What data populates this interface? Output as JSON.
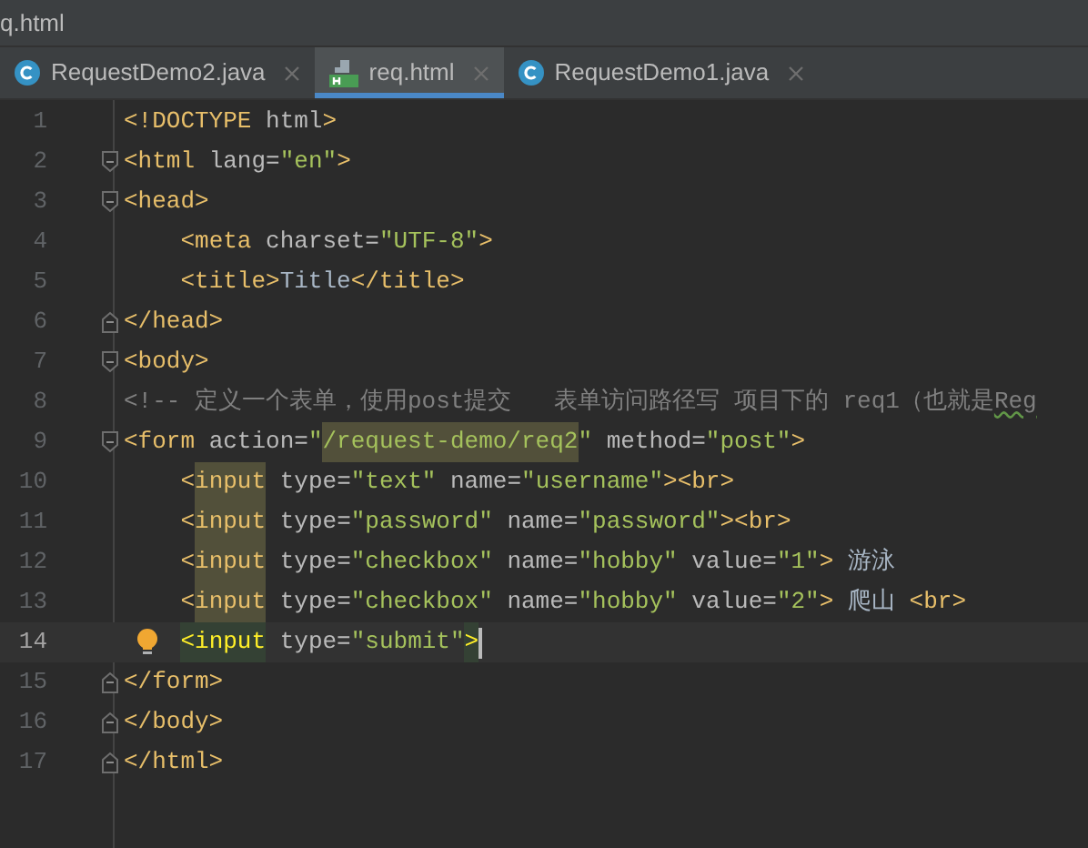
{
  "window": {
    "title": "q.html"
  },
  "tabs": [
    {
      "label": "RequestDemo2.java",
      "kind": "class",
      "selected": false
    },
    {
      "label": "req.html",
      "kind": "html",
      "selected": true
    },
    {
      "label": "RequestDemo1.java",
      "kind": "class",
      "selected": false
    }
  ],
  "editor": {
    "lines": [
      {
        "number": "1",
        "fold_start": false,
        "fold_end": false,
        "current": false,
        "bulb": false,
        "tokens": [
          {
            "text": "<!DOCTYPE",
            "kind": "tag"
          },
          {
            "text": " html",
            "kind": "attr"
          },
          {
            "text": ">",
            "kind": "tag"
          }
        ]
      },
      {
        "number": "2",
        "fold_start": true,
        "fold_end": false,
        "current": false,
        "bulb": false,
        "tokens": [
          {
            "text": "<html",
            "kind": "tag"
          },
          {
            "text": " lang=",
            "kind": "attr"
          },
          {
            "text": "\"en\"",
            "kind": "str"
          },
          {
            "text": ">",
            "kind": "tag"
          }
        ]
      },
      {
        "number": "3",
        "fold_start": true,
        "fold_end": false,
        "current": false,
        "bulb": false,
        "tokens": [
          {
            "text": "<head>",
            "kind": "tag"
          }
        ]
      },
      {
        "number": "4",
        "fold_start": false,
        "fold_end": false,
        "current": false,
        "bulb": false,
        "tokens": [
          {
            "text": "    <meta",
            "kind": "tag"
          },
          {
            "text": " charset=",
            "kind": "attr"
          },
          {
            "text": "\"UTF-8\"",
            "kind": "str"
          },
          {
            "text": ">",
            "kind": "tag"
          }
        ]
      },
      {
        "number": "5",
        "fold_start": false,
        "fold_end": false,
        "current": false,
        "bulb": false,
        "tokens": [
          {
            "text": "    <title>",
            "kind": "tag"
          },
          {
            "text": "Title",
            "kind": "text"
          },
          {
            "text": "</title>",
            "kind": "tag"
          }
        ]
      },
      {
        "number": "6",
        "fold_start": false,
        "fold_end": true,
        "current": false,
        "bulb": false,
        "tokens": [
          {
            "text": "</head>",
            "kind": "tag"
          }
        ]
      },
      {
        "number": "7",
        "fold_start": true,
        "fold_end": false,
        "current": false,
        "bulb": false,
        "tokens": [
          {
            "text": "<body>",
            "kind": "tag"
          }
        ]
      },
      {
        "number": "8",
        "fold_start": false,
        "fold_end": false,
        "current": false,
        "bulb": false,
        "tokens": [
          {
            "text": "<!-- 定义一个表单，使用post提交   表单访问路径写 项目下的 req1（也就是",
            "kind": "comment"
          },
          {
            "text": "Reg",
            "kind": "comment_typo"
          }
        ]
      },
      {
        "number": "9",
        "fold_start": true,
        "fold_end": false,
        "current": false,
        "bulb": false,
        "tokens": [
          {
            "text": "<form",
            "kind": "tag"
          },
          {
            "text": " action=",
            "kind": "attr"
          },
          {
            "text": "\"",
            "kind": "str"
          },
          {
            "text": "/request-demo/req2",
            "kind": "str_match"
          },
          {
            "text": "\"",
            "kind": "str"
          },
          {
            "text": " method=",
            "kind": "attr"
          },
          {
            "text": "\"post\"",
            "kind": "str"
          },
          {
            "text": ">",
            "kind": "tag"
          }
        ]
      },
      {
        "number": "10",
        "fold_start": false,
        "fold_end": false,
        "current": false,
        "bulb": false,
        "tokens": [
          {
            "text": "    <",
            "kind": "tag"
          },
          {
            "text": "input",
            "kind": "tag_match"
          },
          {
            "text": " type=",
            "kind": "attr"
          },
          {
            "text": "\"text\"",
            "kind": "str"
          },
          {
            "text": " name=",
            "kind": "attr"
          },
          {
            "text": "\"username\"",
            "kind": "str"
          },
          {
            "text": "><br>",
            "kind": "tag"
          }
        ]
      },
      {
        "number": "11",
        "fold_start": false,
        "fold_end": false,
        "current": false,
        "bulb": false,
        "tokens": [
          {
            "text": "    <",
            "kind": "tag"
          },
          {
            "text": "input",
            "kind": "tag_match"
          },
          {
            "text": " type=",
            "kind": "attr"
          },
          {
            "text": "\"password\"",
            "kind": "str"
          },
          {
            "text": " name=",
            "kind": "attr"
          },
          {
            "text": "\"password\"",
            "kind": "str"
          },
          {
            "text": "><br>",
            "kind": "tag"
          }
        ]
      },
      {
        "number": "12",
        "fold_start": false,
        "fold_end": false,
        "current": false,
        "bulb": false,
        "tokens": [
          {
            "text": "    <",
            "kind": "tag"
          },
          {
            "text": "input",
            "kind": "tag_match"
          },
          {
            "text": " type=",
            "kind": "attr"
          },
          {
            "text": "\"checkbox\"",
            "kind": "str"
          },
          {
            "text": " name=",
            "kind": "attr"
          },
          {
            "text": "\"hobby\"",
            "kind": "str"
          },
          {
            "text": " value=",
            "kind": "attr"
          },
          {
            "text": "\"1\"",
            "kind": "str"
          },
          {
            "text": ">",
            "kind": "tag"
          },
          {
            "text": " 游泳",
            "kind": "text"
          }
        ]
      },
      {
        "number": "13",
        "fold_start": false,
        "fold_end": false,
        "current": false,
        "bulb": false,
        "tokens": [
          {
            "text": "    <",
            "kind": "tag"
          },
          {
            "text": "input",
            "kind": "tag_match"
          },
          {
            "text": " type=",
            "kind": "attr"
          },
          {
            "text": "\"checkbox\"",
            "kind": "str"
          },
          {
            "text": " name=",
            "kind": "attr"
          },
          {
            "text": "\"hobby\"",
            "kind": "str"
          },
          {
            "text": " value=",
            "kind": "attr"
          },
          {
            "text": "\"2\"",
            "kind": "str"
          },
          {
            "text": ">",
            "kind": "tag"
          },
          {
            "text": " 爬山 ",
            "kind": "text"
          },
          {
            "text": "<br>",
            "kind": "tag"
          }
        ]
      },
      {
        "number": "14",
        "fold_start": false,
        "fold_end": false,
        "current": true,
        "bulb": true,
        "tokens": [
          {
            "text": "    <input",
            "kind": "tag_brace"
          },
          {
            "text": " type=",
            "kind": "attr"
          },
          {
            "text": "\"submit\"",
            "kind": "str"
          },
          {
            "text": ">",
            "kind": "tag_brace"
          }
        ]
      },
      {
        "number": "15",
        "fold_start": false,
        "fold_end": true,
        "current": false,
        "bulb": false,
        "tokens": [
          {
            "text": "</form>",
            "kind": "tag"
          }
        ]
      },
      {
        "number": "16",
        "fold_start": false,
        "fold_end": true,
        "current": false,
        "bulb": false,
        "tokens": [
          {
            "text": "</body>",
            "kind": "tag"
          }
        ]
      },
      {
        "number": "17",
        "fold_start": false,
        "fold_end": true,
        "current": false,
        "bulb": false,
        "tokens": [
          {
            "text": "</html>",
            "kind": "tag"
          }
        ]
      }
    ]
  }
}
